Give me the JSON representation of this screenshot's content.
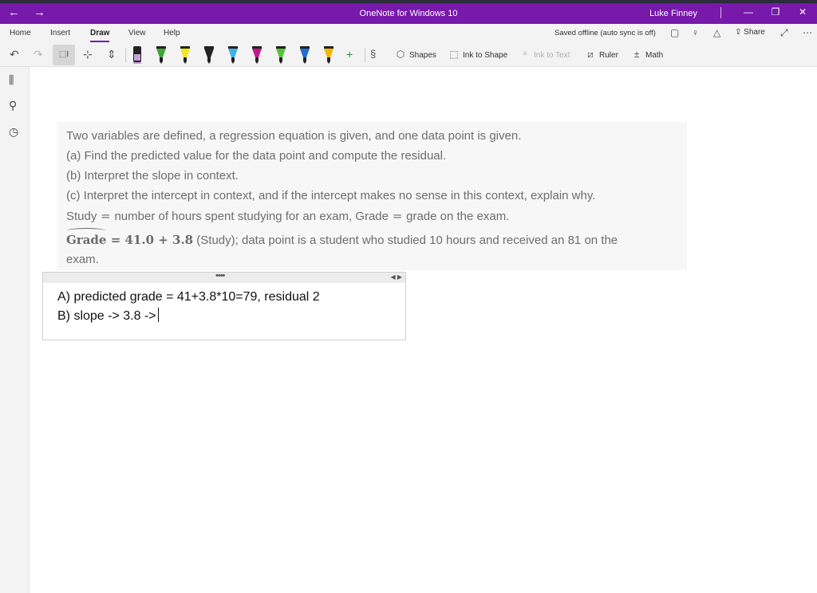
{
  "window": {
    "title": "OneNote for Windows 10",
    "user": "Luke Finney",
    "back_glyph": "←",
    "forward_glyph": "→",
    "minimize_glyph": "—",
    "restore_glyph": "❐",
    "close_glyph": "✕",
    "accent": "#7719aa"
  },
  "menu": {
    "tabs": [
      "Home",
      "Insert",
      "Draw",
      "View",
      "Help"
    ],
    "active_tab": "Draw",
    "status": "Saved offline (auto sync is off)",
    "share_label": "Share"
  },
  "toolbar": {
    "lasso_label": "⬚I",
    "shapes_label": "Shapes",
    "ink_to_shape_label": "Ink to Shape",
    "ink_to_text_label": "Ink to Text",
    "ruler_label": "Ruler",
    "math_label": "Math",
    "pen_colors": [
      "#c8a0d8",
      "#3fa535",
      "#f5e61c",
      "#222222",
      "#3fb0e8",
      "#c2178a",
      "#59c23a",
      "#1f6fd1",
      "#f2b705"
    ]
  },
  "problem": {
    "line1": "Two variables are defined, a regression equation is given, and one data point is given.",
    "line2": "(a) Find the predicted value for the data point and compute the residual.",
    "line3": "(b) Interpret the slope in context.",
    "line4": "(c) Interpret the intercept in context, and if the intercept makes no sense in this context, explain why.",
    "line5_study": "Study",
    "line5_eq": " = ",
    "line5_study_def": "number of hours spent studying for an exam, Grade",
    "line5_grade_def": "grade on the exam.",
    "eq_var": "Grade",
    "eq_rhs": " = 41.0 + 3.8",
    "eq_tail": " (Study); data point is a student who studied 10 hours and received an 81 on the",
    "line7": "exam."
  },
  "notes": {
    "line_a": "A) predicted grade = 41+3.8*10=79, residual 2",
    "line_b": "B) slope -> 3.8 ->",
    "handle_dots": "••••",
    "handle_arrows": "◀ ▶"
  }
}
